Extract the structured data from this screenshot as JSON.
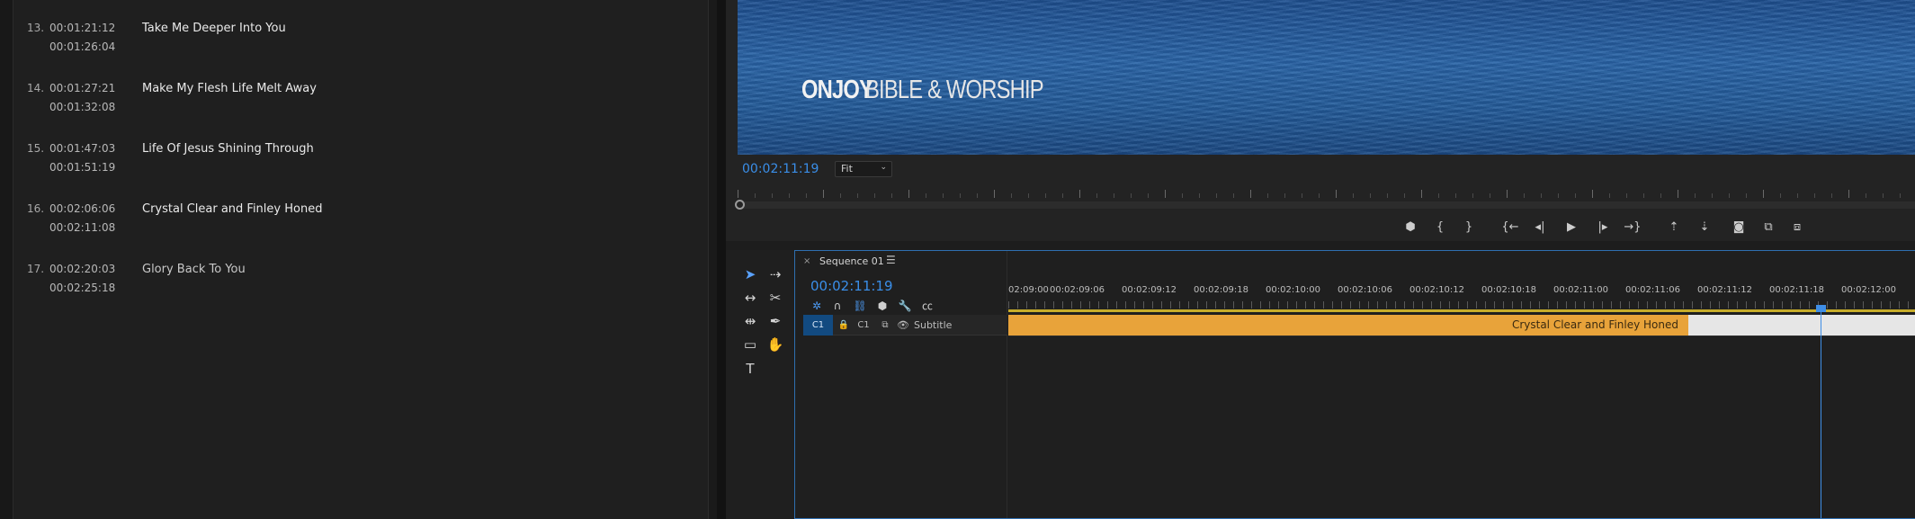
{
  "captions": [
    {
      "num": "13.",
      "in": "00:01:21:12",
      "out": "00:01:26:04",
      "text": "Take Me Deeper Into You",
      "dim": false
    },
    {
      "num": "14.",
      "in": "00:01:27:21",
      "out": "00:01:32:08",
      "text": "Make My Flesh Life Melt Away",
      "dim": false
    },
    {
      "num": "15.",
      "in": "00:01:47:03",
      "out": "00:01:51:19",
      "text": "Life Of Jesus Shining Through",
      "dim": false
    },
    {
      "num": "16.",
      "in": "00:02:06:06",
      "out": "00:02:11:08",
      "text": "Crystal Clear and Finley Honed",
      "dim": false
    },
    {
      "num": "17.",
      "in": "00:02:20:03",
      "out": "00:02:25:18",
      "text": "Glory Back To You",
      "dim": true
    }
  ],
  "monitor": {
    "watermark_bold": "ONJOY",
    "watermark_rest": "BIBLE & WORSHIP",
    "timecode": "00:02:11:19",
    "fit_value": "Fit",
    "transport_icons": [
      "add-marker-icon",
      "mark-in-icon",
      "mark-out-icon",
      "go-to-in-icon",
      "step-back-icon",
      "play-icon",
      "step-forward-icon",
      "go-to-out-icon",
      "lift-icon",
      "extract-icon",
      "export-frame-icon",
      "insert-icon",
      "overwrite-icon"
    ],
    "transport_glyphs": [
      "⬢",
      "{",
      "}",
      "{←",
      "◂|",
      "▶",
      "|▸",
      "→}",
      "⇡",
      "⇣",
      "◙",
      "⧉",
      "⧈"
    ]
  },
  "timeline": {
    "close_glyph": "×",
    "sequence_name": "Sequence 01",
    "menu_glyph": "☰",
    "timecode": "00:02:11:19",
    "track_c1": "C1",
    "track_c1_b": "C1",
    "track_name": "Subtitle",
    "clip_label": "Crystal Clear and Finley Honed",
    "ruler_labels": [
      "02:09:00",
      "00:02:09:06",
      "00:02:09:12",
      "00:02:09:18",
      "00:02:10:00",
      "00:02:10:06",
      "00:02:10:12",
      "00:02:10:18",
      "00:02:11:00",
      "00:02:11:06",
      "00:02:11:12",
      "00:02:11:18",
      "00:02:12:00"
    ]
  },
  "colors": {
    "accent": "#3a8ee8",
    "clip": "#e8a33a",
    "track_target": "#124a80"
  }
}
